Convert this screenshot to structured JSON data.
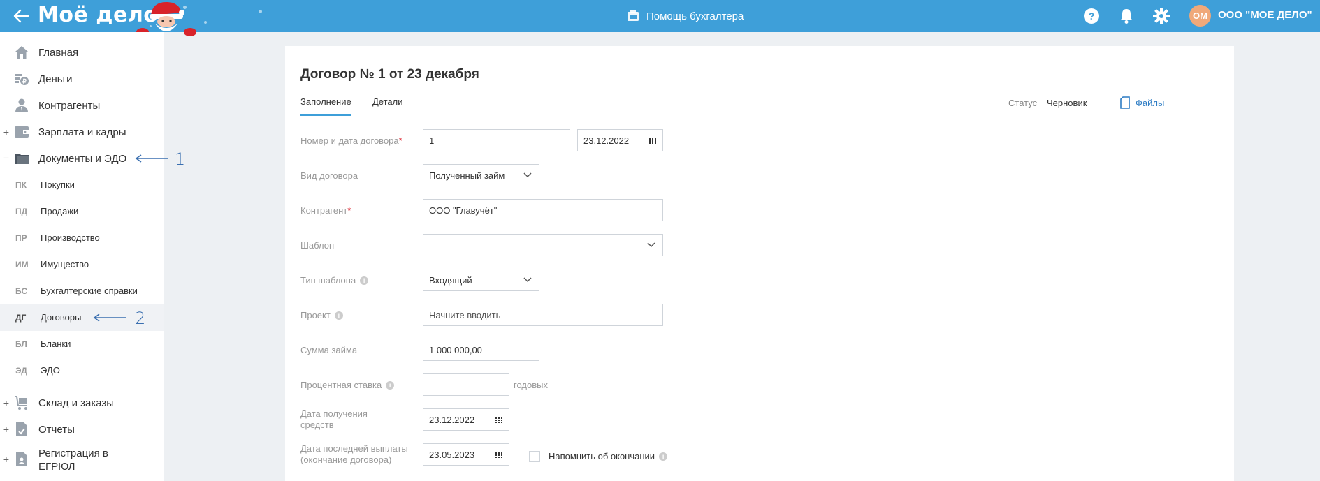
{
  "header": {
    "logo": "Моё дело",
    "help_label": "Помощь бухгалтера",
    "avatar_initials": "ОМ",
    "org_name": "ООО \"МОЕ ДЕЛО\"",
    "colors": {
      "bar": "#3e9fd9",
      "avatar": "#f0a97a"
    }
  },
  "sidebar": {
    "items": [
      {
        "label": "Главная",
        "icon": "home-icon",
        "toggle": ""
      },
      {
        "label": "Деньги",
        "icon": "money-icon",
        "toggle": ""
      },
      {
        "label": "Контрагенты",
        "icon": "contractors-icon",
        "toggle": ""
      },
      {
        "label": "Зарплата и кадры",
        "icon": "wallet-icon",
        "toggle": "+"
      },
      {
        "label": "Документы и ЭДО",
        "icon": "folder-icon",
        "toggle": "−"
      },
      {
        "label": "Склад и заказы",
        "icon": "warehouse-icon",
        "toggle": "+"
      },
      {
        "label": "Отчеты",
        "icon": "reports-icon",
        "toggle": "+"
      },
      {
        "label": "Регистрация в ЕГРЮЛ",
        "icon": "registration-icon",
        "toggle": "+"
      }
    ],
    "subitems": [
      {
        "abbr": "ПК",
        "label": "Покупки"
      },
      {
        "abbr": "ПД",
        "label": "Продажи"
      },
      {
        "abbr": "ПР",
        "label": "Производство"
      },
      {
        "abbr": "ИМ",
        "label": "Имущество"
      },
      {
        "abbr": "БС",
        "label": "Бухгалтерские справки"
      },
      {
        "abbr": "ДГ",
        "label": "Договоры"
      },
      {
        "abbr": "БЛ",
        "label": "Бланки"
      },
      {
        "abbr": "ЭД",
        "label": "ЭДО"
      }
    ],
    "annotations": [
      "1",
      "2"
    ]
  },
  "document": {
    "title": "Договор № 1 от 23 декабря",
    "tabs": [
      "Заполнение",
      "Детали"
    ],
    "status_label": "Статус",
    "status_value": "Черновик",
    "files_label": "Файлы"
  },
  "form": {
    "number_date": {
      "label": "Номер и дата договора",
      "required": "*",
      "number": "1",
      "date": "23.12.2022"
    },
    "contract_type": {
      "label": "Вид договора",
      "value": "Полученный займ"
    },
    "contractor": {
      "label": "Контрагент",
      "required": "*",
      "value": "ООО \"Главучёт\""
    },
    "template": {
      "label": "Шаблон",
      "value": ""
    },
    "template_type": {
      "label": "Тип шаблона",
      "value": "Входящий"
    },
    "project": {
      "label": "Проект",
      "placeholder": "Начните вводить"
    },
    "loan_amount": {
      "label": "Сумма займа",
      "value": "1 000 000,00"
    },
    "interest_rate": {
      "label": "Процентная ставка",
      "value": "",
      "suffix": "годовых"
    },
    "receive_date": {
      "label_line1": "Дата получения",
      "label_line2": "средств",
      "value": "23.12.2022"
    },
    "last_payment_date": {
      "label_line1": "Дата последней выплаты",
      "label_line2": "(окончание договора)",
      "value": "23.05.2023"
    },
    "remind": {
      "label": "Напомнить об окончании",
      "checked": false
    }
  }
}
